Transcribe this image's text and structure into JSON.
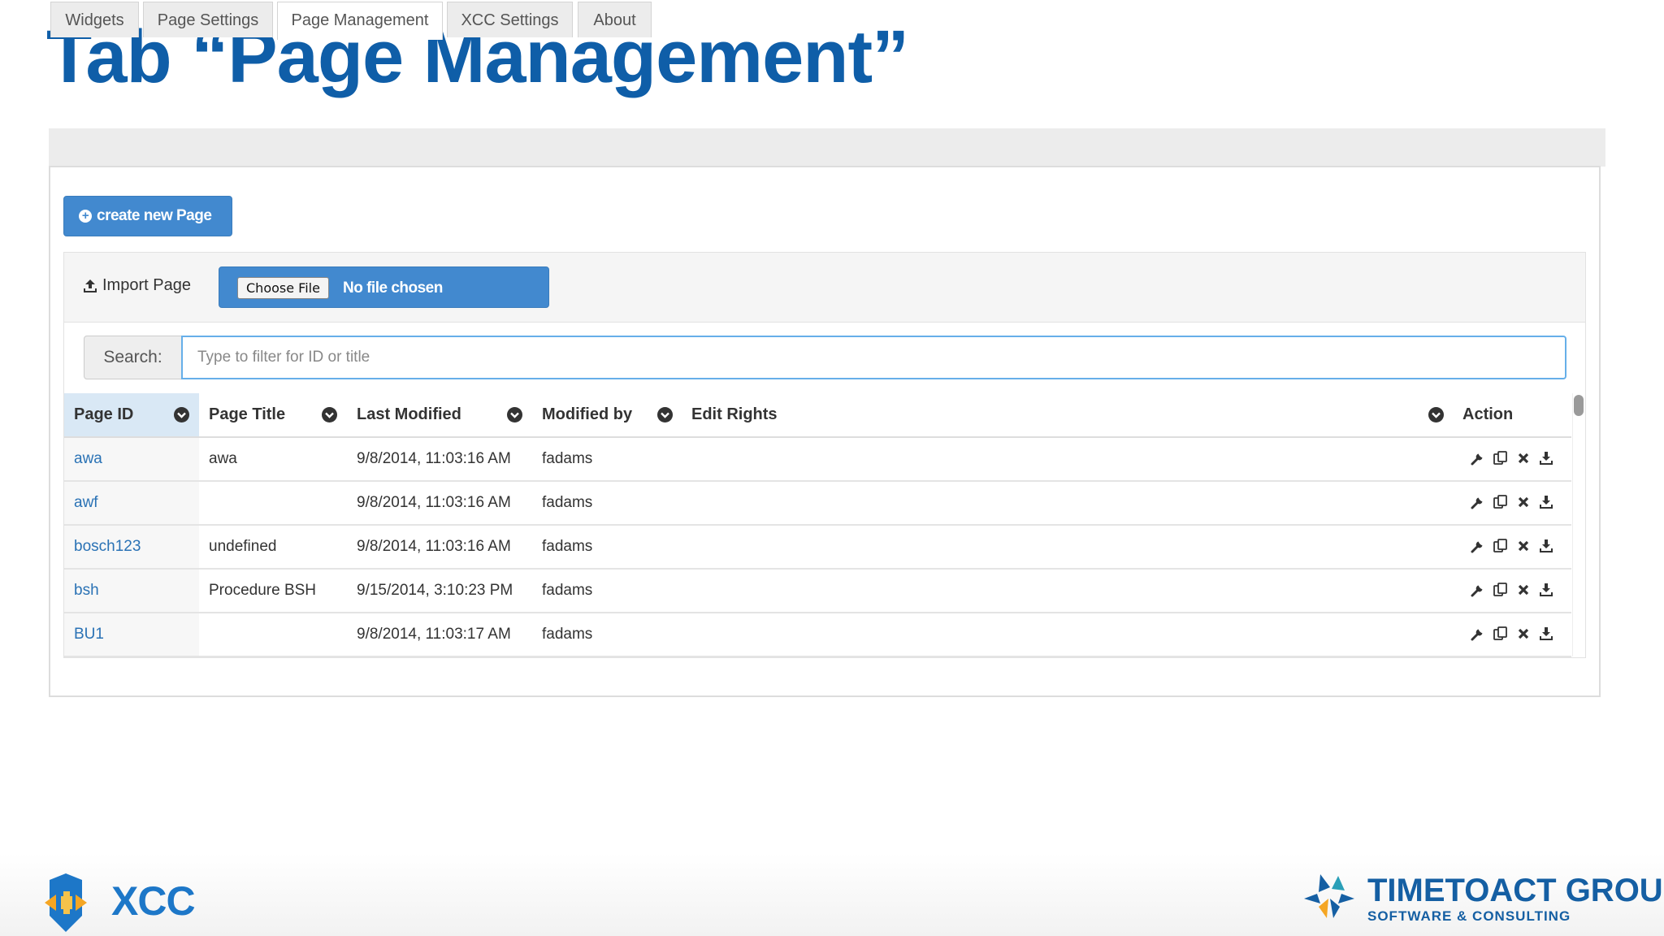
{
  "slide": {
    "title": "Tab “Page Management”"
  },
  "tabs": [
    {
      "label": "Widgets"
    },
    {
      "label": "Page Settings"
    },
    {
      "label": "Page Management",
      "active": true
    },
    {
      "label": "XCC Settings"
    },
    {
      "label": "About"
    }
  ],
  "toolbar": {
    "create_label": "create new Page"
  },
  "import": {
    "label": "Import Page",
    "choose_file_label": "Choose File",
    "file_status": "No file chosen"
  },
  "search": {
    "label": "Search:",
    "placeholder": "Type to filter for ID or title"
  },
  "table": {
    "columns": [
      "Page ID",
      "Page Title",
      "Last Modified",
      "Modified by",
      "Edit Rights",
      "Action"
    ],
    "rows": [
      {
        "id": "awa",
        "title": "awa",
        "modified": "9/8/2014, 11:03:16 AM",
        "by": "fadams"
      },
      {
        "id": "awf",
        "title": "",
        "modified": "9/8/2014, 11:03:16 AM",
        "by": "fadams"
      },
      {
        "id": "bosch123",
        "title": "undefined",
        "modified": "9/8/2014, 11:03:16 AM",
        "by": "fadams"
      },
      {
        "id": "bsh",
        "title": "Procedure BSH",
        "modified": "9/15/2014, 3:10:23 PM",
        "by": "fadams"
      },
      {
        "id": "BU1",
        "title": "",
        "modified": "9/8/2014, 11:03:17 AM",
        "by": "fadams"
      }
    ],
    "row_action_icons": [
      "wrench-icon",
      "copy-icon",
      "delete-icon",
      "download-icon"
    ]
  },
  "footer": {
    "left_logo_text": "XCC",
    "right_logo_name": "TIMETOACT GROUP",
    "right_logo_sub": "SOFTWARE & CONSULTING"
  },
  "colors": {
    "title": "#0f5ea8",
    "primary_button": "#4289cf",
    "link": "#2a72b5",
    "sorted_header": "#d9e8f5"
  }
}
